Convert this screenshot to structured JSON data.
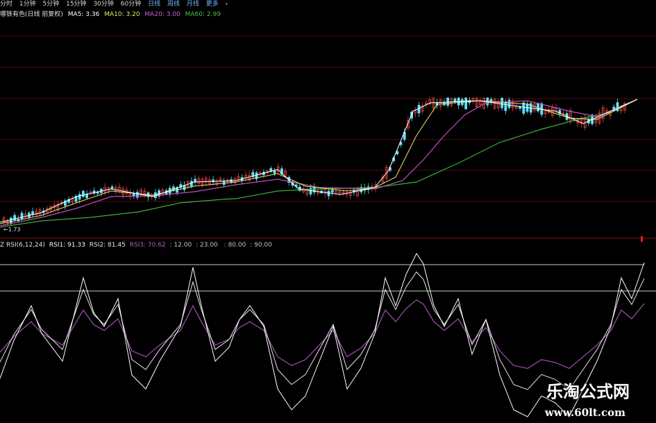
{
  "toolbar": {
    "items": [
      "分时",
      "1分钟",
      "5分钟",
      "15分钟",
      "30分钟",
      "60分钟",
      "日线",
      "周线",
      "月线",
      "更多",
      "›"
    ],
    "active": "日线"
  },
  "price_panel": {
    "name": "哪铁有色(日线 前复权)",
    "ma5": "MA5: 3.36",
    "ma10": "MA10: 3.20",
    "ma20": "MA20: 3.00",
    "ma60": "MA60: 2.99",
    "low_label": "←1.73",
    "colors": {
      "ma5": "#ffffff",
      "ma10": "#e8e86a",
      "ma20": "#c050c0",
      "ma60": "#3ab03a",
      "up": "#e04040",
      "down": "#60e0ff"
    }
  },
  "rsi_panel": {
    "name": "Z RSI(6,12,24)",
    "rsi1": "RSI1: 91.33",
    "rsi2": "RSI2: 81.45",
    "rsi3": "RSI3: 70.62",
    "extra1": ": 12.00",
    "extra2": ": 23.00",
    "extra3": "",
    "extra4": ": 80.00",
    "extra5": ": 90.00",
    "colors": {
      "rsi1": "#ffffff",
      "rsi2": "#e8e8e8",
      "rsi3": "#a050b0",
      "grid": "#c8c8c8"
    }
  },
  "watermark": {
    "title": "乐淘公式网",
    "url": "www.60lt.com"
  }
}
